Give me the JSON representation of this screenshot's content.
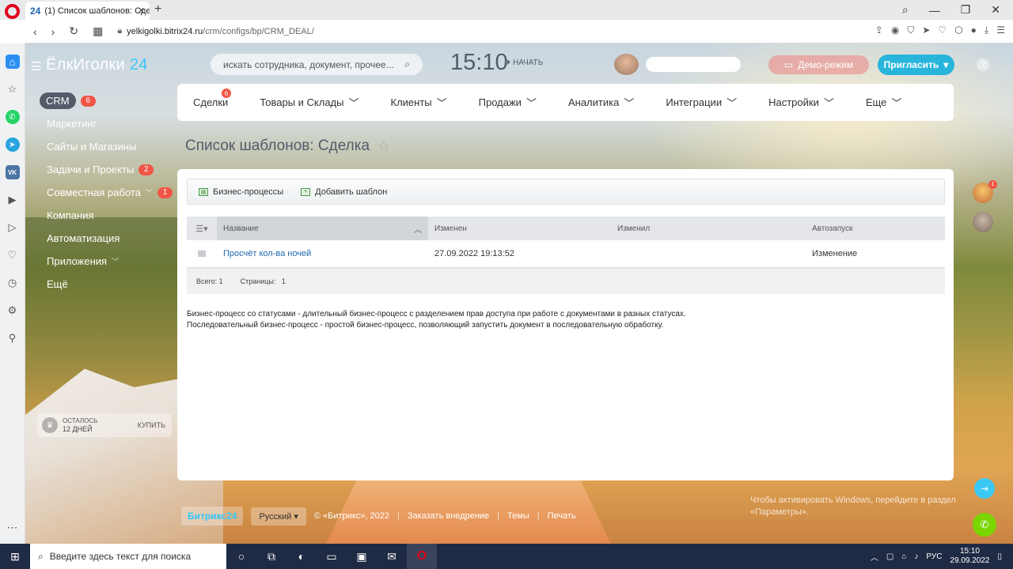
{
  "browser": {
    "tab_favicon": "24",
    "tab_title": "(1) Список шаблонов: Сде",
    "url_domain": "yelkigolki.bitrix24.ru",
    "url_path": "/crm/configs/bp/CRM_DEAL/"
  },
  "header": {
    "brand_name": "ЁлкИголки",
    "brand_num": "24",
    "search_placeholder": "искать сотрудника, документ, прочее...",
    "clock": "15:10",
    "start_label": "НАЧАТЬ",
    "demo_label": "Демо-режим",
    "invite_label": "Пригласить",
    "help_label": "?"
  },
  "leftmenu": {
    "items": [
      {
        "label": "CRM",
        "badge": "6"
      },
      {
        "label": "Маркетинг"
      },
      {
        "label": "Сайты и Магазины"
      },
      {
        "label": "Задачи и Проекты",
        "badge": "2"
      },
      {
        "label": "Совместная работа",
        "badge": "1"
      },
      {
        "label": "Компания"
      },
      {
        "label": "Автоматизация"
      },
      {
        "label": "Приложения"
      },
      {
        "label": "Ещё"
      }
    ],
    "trial_line1": "ОСТАЛОСЬ",
    "trial_line2": "12 ДНЕЙ",
    "trial_buy": "КУПИТЬ"
  },
  "topmenu": {
    "items": [
      {
        "label": "Сделки",
        "badge": "6"
      },
      {
        "label": "Товары и Склады"
      },
      {
        "label": "Клиенты"
      },
      {
        "label": "Продажи"
      },
      {
        "label": "Аналитика"
      },
      {
        "label": "Интеграции"
      },
      {
        "label": "Настройки"
      },
      {
        "label": "Еще"
      }
    ]
  },
  "page": {
    "title": "Список шаблонов: Сделка"
  },
  "toolbar": {
    "bp_label": "Бизнес-процессы",
    "add_label": "Добавить шаблон"
  },
  "grid": {
    "headers": {
      "name": "Название",
      "modified": "Изменен",
      "modified_by": "Изменил",
      "autorun": "Автозапуск"
    },
    "rows": [
      {
        "name": "Просчёт кол-ва ночей",
        "modified": "27.09.2022 19:13:52",
        "modified_by": "",
        "autorun": "Изменение"
      }
    ],
    "total_label": "Всего: 1",
    "pages_label": "Страницы:",
    "pages_value": "1"
  },
  "description": {
    "line1": "Бизнес-процесс со статусами - длительный бизнес-процесс с разделением прав доступа при работе с документами в разных статусах.",
    "line2": "Последовательный бизнес-процесс - простой бизнес-процесс, позволяющий запустить документ в последовательную обработку."
  },
  "footer": {
    "logo": "Битрикс24",
    "lang": "Русский",
    "copyright": "© «Битрикс», 2022",
    "order": "Заказать внедрение",
    "themes": "Темы",
    "print": "Печать"
  },
  "windows": {
    "activate_text": "Чтобы активировать Windows, перейдите в раздел «Параметры».",
    "search_placeholder": "Введите здесь текст для поиска",
    "lang": "РУС",
    "time": "15:10",
    "date": "29.09.2022"
  }
}
